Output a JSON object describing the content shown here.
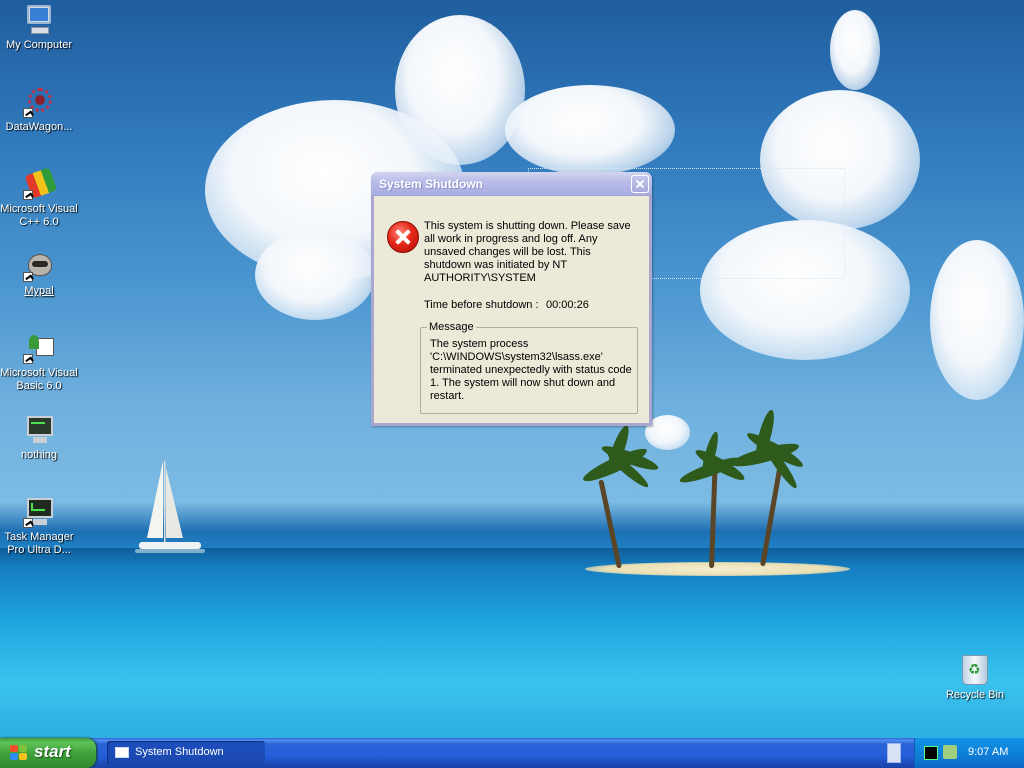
{
  "desktop": {
    "icons": [
      {
        "label": "My Computer",
        "icon": "my-computer-icon"
      },
      {
        "label": "DataWagon...",
        "icon": "datawagon-icon"
      },
      {
        "label": "Microsoft Visual C++ 6.0",
        "icon": "visual-cpp-icon"
      },
      {
        "label": "Mypal",
        "icon": "mypal-icon"
      },
      {
        "label": "Microsoft Visual Basic 6.0",
        "icon": "visual-basic-icon"
      },
      {
        "label": "nothing",
        "icon": "application-monitor-icon"
      },
      {
        "label": "Task Manager Pro Ultra D...",
        "icon": "task-manager-icon"
      }
    ],
    "recycle_bin": {
      "label": "Recycle Bin",
      "icon": "recycle-bin-icon"
    }
  },
  "dialog": {
    "title": "System Shutdown",
    "message": "This system is shutting down. Please save all work in progress and log off. Any unsaved changes will be lost. This shutdown was initiated by NT AUTHORITY\\SYSTEM",
    "time_label": "Time before shutdown :",
    "time_value": "00:00:26",
    "group_label": "Message",
    "group_text": "The system process\n'C:\\WINDOWS\\system32\\lsass.exe'\nterminated unexpectedly with status code\n1.  The system will now shut down and\nrestart."
  },
  "taskbar": {
    "start_label": "start",
    "items": [
      {
        "label": "System Shutdown",
        "icon": "window-icon"
      }
    ],
    "clock": "9:07 AM"
  },
  "colors": {
    "dialog_title_bar": "#b9bde8",
    "dialog_body": "#ece9d8",
    "taskbar": "#245edb",
    "start_button": "#3fa23a",
    "error": "#e5281a"
  }
}
